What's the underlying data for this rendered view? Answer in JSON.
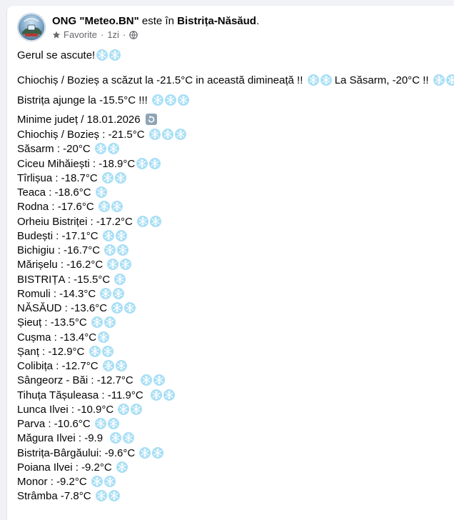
{
  "post": {
    "author": "ONG \"Meteo.BN\"",
    "connector": " este în ",
    "location": "Bistrița-Năsăud",
    "audience_label": "Favorite",
    "separator": "·",
    "time": "1zi",
    "icons": {
      "audience": "star-icon",
      "privacy": "globe-icon",
      "avatar": "meteo-logo"
    }
  },
  "paragraphs": [
    {
      "text": "Gerul se ascute!",
      "flakes": 2
    },
    {
      "text": "Chiochiș / Bozieș a scăzut la -21.5°C in această dimineață !! ",
      "flakes": 2,
      "text2": " La Săsarm, -20°C !! ",
      "flakes2": 2
    },
    {
      "text": "Bistrița ajunge la -15.5°C !!!",
      "flakes": 3
    },
    {
      "text": "Minime județ / 18.01.2026",
      "icon": "redo-icon"
    }
  ],
  "minima": [
    {
      "text": "Chiochiș / Bozieș : -21.5°C ",
      "flakes": 3
    },
    {
      "text": "Săsarm : -20°C ",
      "flakes": 2
    },
    {
      "text": "Ciceu Mihăiești : -18.9°C",
      "flakes": 2
    },
    {
      "text": "Tîrlișua : -18.7°C ",
      "flakes": 2
    },
    {
      "text": "Teaca : -18.6°C ",
      "flakes": 1
    },
    {
      "text": "Rodna : -17.6°C ",
      "flakes": 2
    },
    {
      "text": "Orheiu Bistriței : -17.2°C ",
      "flakes": 2
    },
    {
      "text": "Budești : -17.1°C ",
      "flakes": 2
    },
    {
      "text": "Bichigiu : -16.7°C ",
      "flakes": 2
    },
    {
      "text": "Mărișelu : -16.2°C ",
      "flakes": 2
    },
    {
      "text": "BISTRIȚA : -15.5°C ",
      "flakes": 1
    },
    {
      "text": "Romuli : -14.3°C ",
      "flakes": 2
    },
    {
      "text": "NĂSĂUD : -13.6°C ",
      "flakes": 2
    },
    {
      "text": "Șieuț : -13.5°C ",
      "flakes": 2
    },
    {
      "text": "Cușma : -13.4°C",
      "flakes": 1
    },
    {
      "text": "Șanț : -12.9°C ",
      "flakes": 2
    },
    {
      "text": "Colibița : -12.7°C ",
      "flakes": 2
    },
    {
      "text": "Sângeorz - Băi : -12.7°C  ",
      "flakes": 2
    },
    {
      "text": "Tihuța Tășuleasa : -11.9°C  ",
      "flakes": 2
    },
    {
      "text": "Lunca Ilvei : -10.9°C ",
      "flakes": 2
    },
    {
      "text": "Parva : -10.6°C ",
      "flakes": 2
    },
    {
      "text": "Măgura Ilvei : -9.9  ",
      "flakes": 2
    },
    {
      "text": "Bistrița-Bârgăului: -9.6°C ",
      "flakes": 2
    },
    {
      "text": "Poiana Ilvei : -9.2°C ",
      "flakes": 1
    },
    {
      "text": "Monor : -9.2°C ",
      "flakes": 2
    },
    {
      "text": "Strâmba -7.8°C ",
      "flakes": 2
    }
  ],
  "colors": {
    "flake": "#a9dff5",
    "flake_stroke": "#ffffff",
    "meta": "#65676b"
  }
}
